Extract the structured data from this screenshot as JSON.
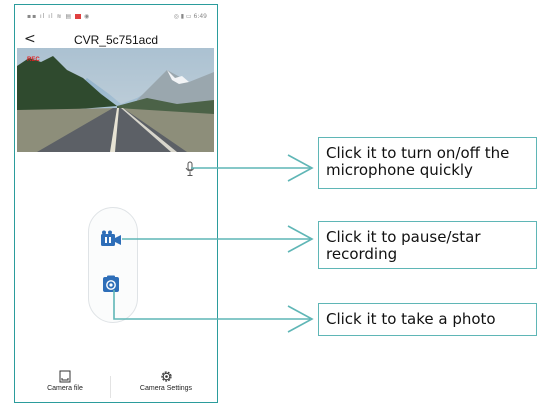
{
  "statusbar": {
    "time": "6:49"
  },
  "header": {
    "title": "CVR_5c751acd",
    "back_glyph": "<"
  },
  "preview": {
    "rec_label": "REC"
  },
  "tabs": [
    {
      "label": "Camera file",
      "icon": "sd-card-icon"
    },
    {
      "label": "Camera Settings",
      "icon": "gear-icon"
    }
  ],
  "callouts": {
    "mic": "Click it to turn on/off the microphone quickly",
    "record": "Click it to pause/star recording",
    "photo": "Click it to take a photo"
  },
  "colors": {
    "accent_line": "#5fb6b6",
    "button_blue": "#2e6eb8",
    "rec_red": "#e02020"
  }
}
